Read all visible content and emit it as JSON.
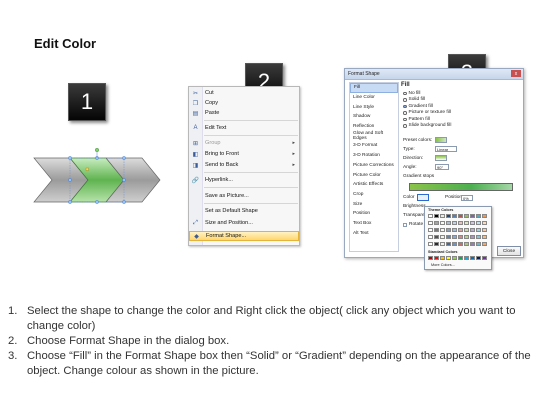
{
  "title": "Edit Color",
  "steps": [
    {
      "number": "1"
    },
    {
      "number": "2"
    },
    {
      "number": "3"
    }
  ],
  "context_menu": {
    "items": [
      {
        "label": "Cut",
        "icon": "scissors-icon"
      },
      {
        "label": "Copy",
        "icon": "copy-icon"
      },
      {
        "label": "Paste",
        "icon": "paste-icon"
      },
      {
        "label": "Edit Text",
        "icon": "edit-text-icon"
      },
      {
        "label": "Group",
        "icon": "group-icon"
      },
      {
        "label": "Bring to Front",
        "icon": "bring-front-icon"
      },
      {
        "label": "Send to Back",
        "icon": "send-back-icon"
      },
      {
        "label": "Hyperlink...",
        "icon": "hyperlink-icon"
      },
      {
        "label": "Save as Picture...",
        "icon": ""
      },
      {
        "label": "Set as Default Shape",
        "icon": ""
      },
      {
        "label": "Size and Position...",
        "icon": "size-icon"
      },
      {
        "label": "Format Shape...",
        "icon": "format-shape-icon"
      }
    ]
  },
  "dialog": {
    "title": "Format Shape",
    "close": "x",
    "nav": [
      "Fill",
      "Line Color",
      "Line Style",
      "Shadow",
      "Reflection",
      "Glow and Soft Edges",
      "3-D Format",
      "3-D Rotation",
      "Picture Corrections",
      "Picture Color",
      "Artistic Effects",
      "Crop",
      "Size",
      "Position",
      "Text Box",
      "Alt Text"
    ],
    "fill_header": "Fill",
    "fill_options": [
      {
        "label": "No fill",
        "selected": false
      },
      {
        "label": "Solid fill",
        "selected": false
      },
      {
        "label": "Gradient fill",
        "selected": true
      },
      {
        "label": "Picture or texture fill",
        "selected": false
      },
      {
        "label": "Pattern fill",
        "selected": false
      },
      {
        "label": "Slide background fill",
        "selected": false
      }
    ],
    "preset_colors": "Preset colors:",
    "type": "Type:",
    "type_value": "Linear",
    "direction": "Direction:",
    "angle": "Angle:",
    "angle_value": "90°",
    "gradient_stops": "Gradient stops",
    "color": "Color",
    "position": "Position:",
    "position_value": "0%",
    "brightness": "Brightness",
    "transparency": "Transparency",
    "rotate": "Rotate with shape",
    "close_button": "Close"
  },
  "color_popup": {
    "theme_colors": "Theme Colors",
    "standard_colors": "Standard Colors",
    "more_colors": "More Colors..."
  },
  "instructions": [
    {
      "num": "1.",
      "text": "Select the shape to change the color and Right click the object( click any object which you want to change color)"
    },
    {
      "num": "2.",
      "text": "Choose Format Shape in the dialog box."
    },
    {
      "num": "3.",
      "text": "Choose “Fill” in the Format Shape box then “Solid” or “Gradient” depending on the appearance of the object. Change colour as shown in the picture."
    }
  ]
}
